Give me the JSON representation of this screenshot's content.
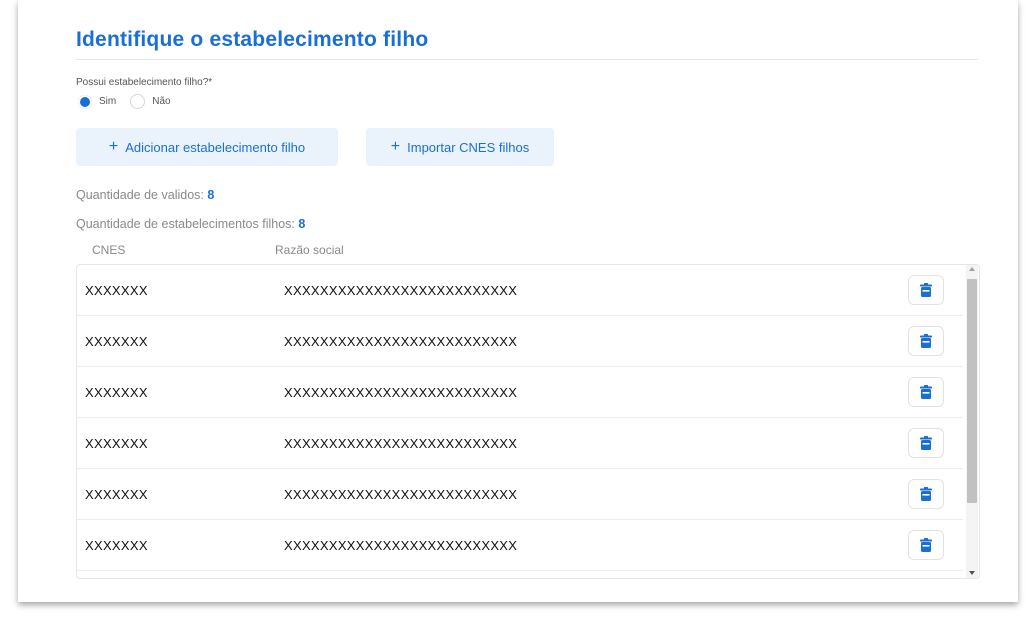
{
  "section": {
    "title": "Identifique o estabelecimento filho",
    "question": "Possui estabelecimento filho?*",
    "options": [
      {
        "label": "Sim",
        "selected": true
      },
      {
        "label": "Não",
        "selected": false
      }
    ]
  },
  "buttons": {
    "add_label": "Adicionar estabelecimento filho",
    "import_label": "Importar CNES filhos",
    "plus_icon": "+"
  },
  "counts": {
    "valid_label": "Quantidade de validos:",
    "valid_value": "8",
    "total_label": "Quantidade de estabelecimentos filhos:",
    "total_value": "8"
  },
  "table": {
    "columns": [
      "CNES",
      "Razão social"
    ],
    "rows": [
      {
        "cnes": "XXXXXXX",
        "razao": "XXXXXXXXXXXXXXXXXXXXXXXXXX"
      },
      {
        "cnes": "XXXXXXX",
        "razao": "XXXXXXXXXXXXXXXXXXXXXXXXXX"
      },
      {
        "cnes": "XXXXXXX",
        "razao": "XXXXXXXXXXXXXXXXXXXXXXXXXX"
      },
      {
        "cnes": "XXXXXXX",
        "razao": "XXXXXXXXXXXXXXXXXXXXXXXXXX"
      },
      {
        "cnes": "XXXXXXX",
        "razao": "XXXXXXXXXXXXXXXXXXXXXXXXXX"
      },
      {
        "cnes": "XXXXXXX",
        "razao": "XXXXXXXXXXXXXXXXXXXXXXXXXX"
      }
    ],
    "row_action_icon": "trash-icon"
  },
  "colors": {
    "accent": "#1a6fd6",
    "button_bg": "#eaf3fc"
  }
}
